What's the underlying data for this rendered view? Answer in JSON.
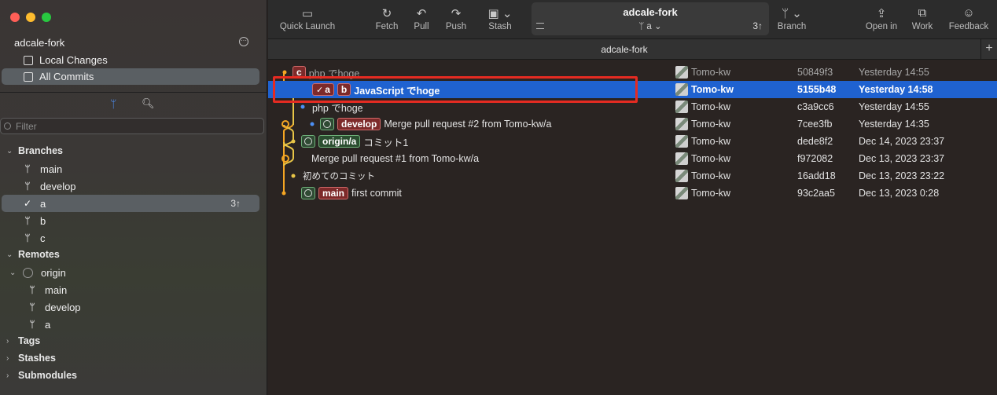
{
  "sidebar": {
    "repo_name": "adcale-fork",
    "nav": [
      {
        "label": "Local Changes"
      },
      {
        "label": "All Commits"
      }
    ],
    "filter_placeholder": "Filter",
    "sections": {
      "branches": "Branches",
      "remotes": "Remotes",
      "tags": "Tags",
      "stashes": "Stashes",
      "submodules": "Submodules"
    },
    "branches": [
      {
        "name": "main"
      },
      {
        "name": "develop"
      },
      {
        "name": "a",
        "ahead": "3↑",
        "current": true
      },
      {
        "name": "b"
      },
      {
        "name": "c"
      }
    ],
    "remote": {
      "name": "origin",
      "branches": [
        {
          "name": "main"
        },
        {
          "name": "develop"
        },
        {
          "name": "a"
        }
      ]
    }
  },
  "toolbar": {
    "quick_launch": "Quick Launch",
    "fetch": "Fetch",
    "pull": "Pull",
    "push": "Push",
    "stash": "Stash",
    "title": "adcale-fork",
    "branch_indicator": "a",
    "ahead_count": "3↑",
    "branch": "Branch",
    "open_in": "Open in",
    "work": "Work",
    "feedback": "Feedback"
  },
  "tab": {
    "label": "adcale-fork"
  },
  "commits": [
    {
      "tags": [
        "c"
      ],
      "message": "php でhoge",
      "author": "Tomo-kw",
      "hash": "50849f3",
      "date": "Yesterday 14:55"
    },
    {
      "tags": [
        "a",
        "b"
      ],
      "message": "JavaScript でhoge",
      "author": "Tomo-kw",
      "hash": "5155b48",
      "date": "Yesterday 14:58"
    },
    {
      "tags": [],
      "message": "php でhoge",
      "author": "Tomo-kw",
      "hash": "c3a9cc6",
      "date": "Yesterday 14:55"
    },
    {
      "tags": [
        "develop"
      ],
      "message": "Merge pull request #2 from Tomo-kw/a",
      "author": "Tomo-kw",
      "hash": "7cee3fb",
      "date": "Yesterday 14:35"
    },
    {
      "tags": [
        "origin/a"
      ],
      "message": "コミット1",
      "author": "Tomo-kw",
      "hash": "dede8f2",
      "date": "Dec 14, 2023 23:37"
    },
    {
      "tags": [],
      "message": "Merge pull request #1 from Tomo-kw/a",
      "author": "Tomo-kw",
      "hash": "f972082",
      "date": "Dec 13, 2023 23:37"
    },
    {
      "tags": [],
      "message": "初めてのコミット",
      "author": "Tomo-kw",
      "hash": "16add18",
      "date": "Dec 13, 2023 23:22"
    },
    {
      "tags": [
        "main"
      ],
      "message": "first commit",
      "author": "Tomo-kw",
      "hash": "93c2aa5",
      "date": "Dec 13, 2023 0:28"
    }
  ],
  "colors": {
    "selection": "#1f62d0",
    "graph_orange": "#f5a623",
    "graph_yellow": "#e8c547",
    "graph_blue": "#4c8ff5",
    "highlight": "#e52b22"
  }
}
